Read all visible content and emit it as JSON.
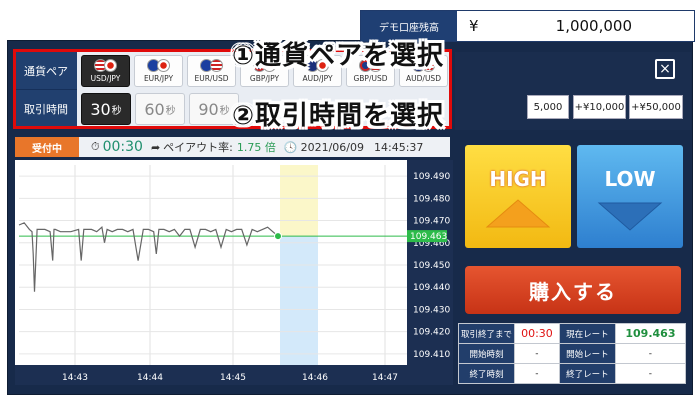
{
  "balance": {
    "label": "デモ口座残高",
    "currency": "¥",
    "value": "1,000,000"
  },
  "pairs_row": {
    "label": "通貨ペア",
    "pairs": [
      {
        "name": "USD/JPY",
        "flags": [
          "us",
          "jp"
        ],
        "selected": true
      },
      {
        "name": "EUR/JPY",
        "flags": [
          "eu",
          "jp"
        ],
        "selected": false
      },
      {
        "name": "EUR/USD",
        "flags": [
          "eu",
          "us"
        ],
        "selected": false
      },
      {
        "name": "GBP/JPY",
        "flags": [
          "gb",
          "jp"
        ],
        "selected": false
      },
      {
        "name": "AUD/JPY",
        "flags": [
          "au",
          "jp"
        ],
        "selected": false
      },
      {
        "name": "GBP/USD",
        "flags": [
          "gb",
          "us"
        ],
        "selected": false
      },
      {
        "name": "AUD/USD",
        "flags": [
          "au",
          "us"
        ],
        "selected": false
      }
    ]
  },
  "time_row": {
    "label": "取引時間",
    "options": [
      {
        "value": "30",
        "unit": "秒",
        "selected": true
      },
      {
        "value": "60",
        "unit": "秒",
        "selected": false
      },
      {
        "value": "90",
        "unit": "秒",
        "selected": false
      }
    ]
  },
  "callouts": {
    "step1": "①通貨ペアを選択",
    "step2": "②取引時間を選択"
  },
  "close_icon": "×",
  "amount_buttons": [
    "5,000",
    "+¥10,000",
    "+¥50,000"
  ],
  "status": {
    "badge": "受付中",
    "countdown": "00:30",
    "payout_label": "ペイアウト率:",
    "payout_value": "1.75 倍",
    "date": "2021/06/09",
    "clock": "14:45:37"
  },
  "chart_data": {
    "type": "line",
    "y_ticks": [
      "109.490",
      "109.480",
      "109.470",
      "109.460",
      "109.450",
      "109.440",
      "109.430",
      "109.420",
      "109.410"
    ],
    "ylim": [
      109.405,
      109.495
    ],
    "x_ticks": [
      "14:43",
      "14:44",
      "14:45",
      "14:46",
      "14:47"
    ],
    "current_rate_label": "109.463",
    "current_rate": 109.463,
    "series": [
      {
        "x": [
          0,
          0.02,
          0.04,
          0.05,
          0.055,
          0.06,
          0.07,
          0.1,
          0.12,
          0.13,
          0.135,
          0.14,
          0.16,
          0.2,
          0.23,
          0.24,
          0.25,
          0.28,
          0.3,
          0.32,
          0.33,
          0.34,
          0.36,
          0.38,
          0.4,
          0.42,
          0.44,
          0.46,
          0.48,
          0.5,
          0.52,
          0.53,
          0.54,
          0.56,
          0.58,
          0.6,
          0.62,
          0.64,
          0.66,
          0.68,
          0.7,
          0.72,
          0.74,
          0.76,
          0.78,
          0.8,
          0.82,
          0.84,
          0.86,
          0.88,
          0.9,
          0.92,
          0.94,
          0.96,
          0.98,
          1.0
        ],
        "y": [
          109.468,
          109.469,
          109.466,
          109.465,
          109.455,
          109.438,
          109.466,
          109.466,
          109.465,
          109.452,
          109.466,
          109.466,
          109.465,
          109.465,
          109.466,
          109.452,
          109.466,
          109.466,
          109.465,
          109.467,
          109.46,
          109.466,
          109.465,
          109.466,
          109.466,
          109.465,
          109.466,
          109.452,
          109.466,
          109.466,
          109.465,
          109.455,
          109.466,
          109.466,
          109.465,
          109.466,
          109.463,
          109.466,
          109.466,
          109.458,
          109.466,
          109.466,
          109.465,
          109.466,
          109.458,
          109.466,
          109.465,
          109.466,
          109.466,
          109.459,
          109.466,
          109.465,
          109.466,
          109.467,
          109.465,
          109.463
        ]
      }
    ]
  },
  "buttons": {
    "high": "HIGH",
    "low": "LOW",
    "buy": "購入する"
  },
  "info": {
    "rows": [
      {
        "l1": "取引終了まで",
        "v1": "00:30",
        "l2": "現在レート",
        "v2": "109.463"
      },
      {
        "l1": "開始時刻",
        "v1": "-",
        "l2": "開始レート",
        "v2": "-"
      },
      {
        "l1": "終了時刻",
        "v1": "-",
        "l2": "終了レート",
        "v2": "-"
      }
    ]
  }
}
